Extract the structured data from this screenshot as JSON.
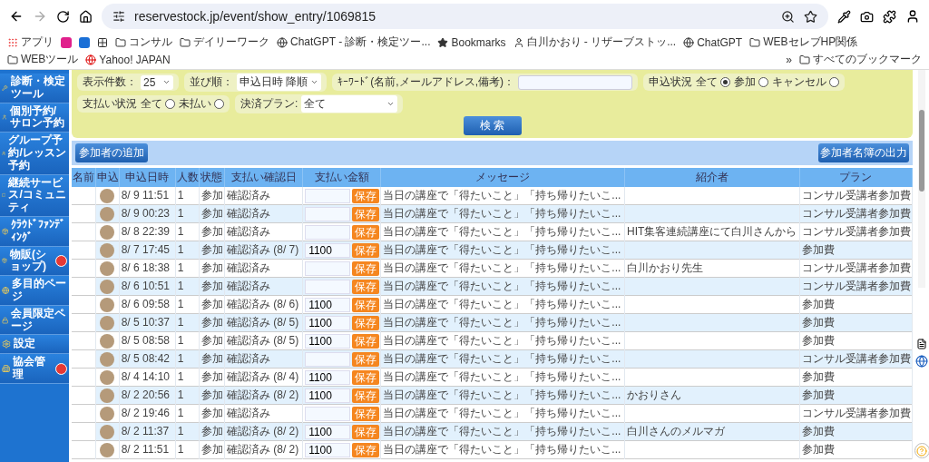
{
  "browser": {
    "url": "reservestock.jp/event/show_entry/1069815",
    "bookmarks": [
      {
        "kind": "apps",
        "label": "アプリ"
      },
      {
        "kind": "color",
        "color": "#e0208c"
      },
      {
        "kind": "color",
        "color": "#1a6fd6"
      },
      {
        "kind": "grid"
      },
      {
        "kind": "folder",
        "label": "コンサル"
      },
      {
        "kind": "folder",
        "label": "デイリーワーク"
      },
      {
        "kind": "site",
        "label": "ChatGPT - 診断・検定ツー..."
      },
      {
        "kind": "star",
        "label": "Bookmarks"
      },
      {
        "kind": "face",
        "label": "白川かおり - リザーブストッ..."
      },
      {
        "kind": "site",
        "label": "ChatGPT"
      },
      {
        "kind": "folder",
        "label": "WEBセレブHP関係"
      },
      {
        "kind": "folder",
        "label": "WEBツール"
      },
      {
        "kind": "yahoo",
        "label": "Yahoo! JAPAN"
      }
    ],
    "more": "»",
    "all_bookmarks": "すべてのブックマーク"
  },
  "sidebar": {
    "items": [
      {
        "label": "診断・検定ツール",
        "badge": false
      },
      {
        "label": "個別予約/サロン予約",
        "badge": false
      },
      {
        "label": "グループ予約/レッスン予約",
        "badge": false
      },
      {
        "label": "継続サービス/コミュニティ",
        "badge": false
      },
      {
        "label": "ｸﾗｳﾄﾞﾌｧﾝﾃﾞｨﾝｸﾞ",
        "badge": false
      },
      {
        "label": "物販(ショップ)",
        "badge": true
      },
      {
        "label": "多目的ページ",
        "badge": false
      },
      {
        "label": "会員限定ページ",
        "badge": false
      },
      {
        "label": "設定",
        "badge": false
      },
      {
        "label": "協会管理",
        "badge": true
      }
    ]
  },
  "filters": {
    "count": {
      "label": "表示件数：",
      "value": "25"
    },
    "order": {
      "label": "並び順：",
      "value": "申込日時 降順"
    },
    "keyword": {
      "label": "ｷｰﾜｰﾄﾞ(名前,メールアドレス,備考)："
    },
    "status": {
      "label": "申込状況",
      "options": [
        {
          "label": "全て",
          "selected": true
        },
        {
          "label": "参加",
          "selected": false
        },
        {
          "label": "キャンセル",
          "selected": false
        }
      ]
    },
    "payment": {
      "label": "支払い状況",
      "options": [
        {
          "label": "全て",
          "selected": false
        },
        {
          "label": "未払い",
          "selected": false
        }
      ]
    },
    "plan": {
      "label": "決済プラン:",
      "value": "全て"
    },
    "search_button": "検 索"
  },
  "actions": {
    "add": "参加者の追加",
    "export": "参加者名簿の出力"
  },
  "table": {
    "columns": [
      "名前",
      "申込",
      "申込日時",
      "人数",
      "状態",
      "支払い確認日",
      "支払い金額",
      "メッセージ",
      "紹介者",
      "プラン"
    ],
    "rows": [
      {
        "date": "8/ 9 11:51",
        "count": "1",
        "status": "参加",
        "confirm": "確認済み",
        "save": "保存",
        "message": "当日の講座で「得たいこと」「持ち帰りたいこ...",
        "plan": "コンサル受講者参加費"
      },
      {
        "date": "8/ 9 00:23",
        "count": "1",
        "status": "参加",
        "confirm": "確認済み",
        "save": "保存",
        "message": "当日の講座で「得たいこと」「持ち帰りたいこ...",
        "plan": "コンサル受講者参加費"
      },
      {
        "date": "8/ 8 22:39",
        "count": "1",
        "status": "参加",
        "confirm": "確認済み",
        "save": "保存",
        "message": "当日の講座で「得たいこと」「持ち帰りたいこ...",
        "referrer": "HIT集客連続講座にて白川さんから",
        "plan": "コンサル受講者参加費"
      },
      {
        "date": "8/ 7 17:45",
        "count": "1",
        "status": "参加",
        "confirm": "確認済み (8/ 7)",
        "amount": "1100",
        "save": "保存",
        "message": "当日の講座で「得たいこと」「持ち帰りたいこ...",
        "plan": "参加費"
      },
      {
        "date": "8/ 6 18:38",
        "count": "1",
        "status": "参加",
        "confirm": "確認済み",
        "save": "保存",
        "message": "当日の講座で「得たいこと」「持ち帰りたいこ...",
        "referrer": "白川かおり先生",
        "plan": "コンサル受講者参加費"
      },
      {
        "date": "8/ 6 10:51",
        "count": "1",
        "status": "参加",
        "confirm": "確認済み",
        "save": "保存",
        "message": "当日の講座で「得たいこと」「持ち帰りたいこ...",
        "plan": "コンサル受講者参加費"
      },
      {
        "date": "8/ 6 09:58",
        "count": "1",
        "status": "参加",
        "confirm": "確認済み (8/ 6)",
        "amount": "1100",
        "save": "保存",
        "message": "当日の講座で「得たいこと」「持ち帰りたいこ...",
        "plan": "参加費"
      },
      {
        "date": "8/ 5 10:37",
        "count": "1",
        "status": "参加",
        "confirm": "確認済み (8/ 5)",
        "amount": "1100",
        "save": "保存",
        "message": "当日の講座で「得たいこと」「持ち帰りたいこ...",
        "plan": "参加費"
      },
      {
        "date": "8/ 5 08:58",
        "count": "1",
        "status": "参加",
        "confirm": "確認済み (8/ 5)",
        "amount": "1100",
        "save": "保存",
        "message": "当日の講座で「得たいこと」「持ち帰りたいこ...",
        "plan": "参加費"
      },
      {
        "date": "8/ 5 08:42",
        "count": "1",
        "status": "参加",
        "confirm": "確認済み",
        "save": "保存",
        "message": "当日の講座で「得たいこと」「持ち帰りたいこ...",
        "plan": "コンサル受講者参加費"
      },
      {
        "date": "8/ 4 14:10",
        "count": "1",
        "status": "参加",
        "confirm": "確認済み (8/ 4)",
        "amount": "1100",
        "save": "保存",
        "message": "当日の講座で「得たいこと」「持ち帰りたいこ...",
        "plan": "参加費"
      },
      {
        "date": "8/ 2 20:56",
        "count": "1",
        "status": "参加",
        "confirm": "確認済み (8/ 2)",
        "amount": "1100",
        "save": "保存",
        "message": "当日の講座で「得たいこと」「持ち帰りたいこ...",
        "referrer": "かおりさん",
        "plan": "参加費"
      },
      {
        "date": "8/ 2 19:46",
        "count": "1",
        "status": "参加",
        "confirm": "確認済み",
        "save": "保存",
        "message": "当日の講座で「得たいこと」「持ち帰りたいこ...",
        "plan": "コンサル受講者参加費"
      },
      {
        "date": "8/ 2 11:37",
        "count": "1",
        "status": "参加",
        "confirm": "確認済み (8/ 2)",
        "amount": "1100",
        "save": "保存",
        "message": "当日の講座で「得たいこと」「持ち帰りたいこ...",
        "referrer": "白川さんのメルマガ",
        "plan": "参加費"
      },
      {
        "date": "8/ 2 11:51",
        "count": "1",
        "status": "参加",
        "confirm": "確認済み (8/ 2)",
        "amount": "1100",
        "save": "保存",
        "message": "当日の講座で「得たいこと」「持ち帰りたいこ...",
        "plan": "参加費"
      }
    ]
  }
}
